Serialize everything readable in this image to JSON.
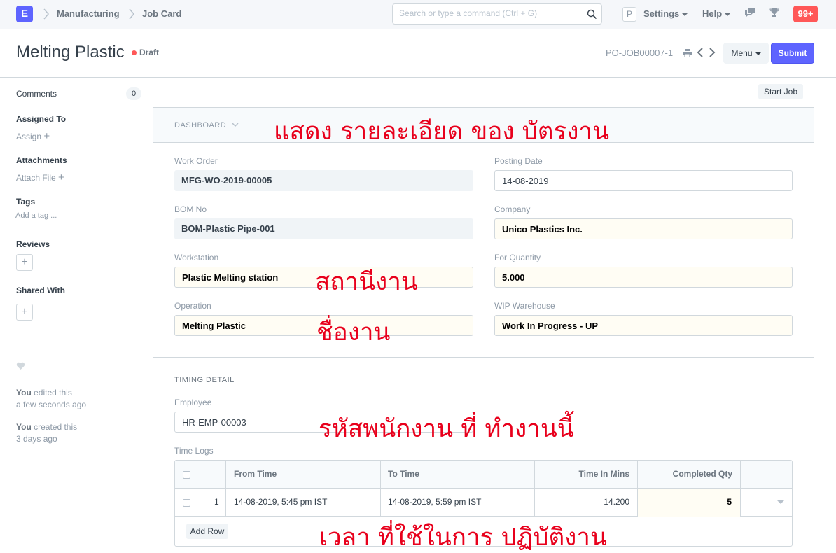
{
  "navbar": {
    "logo": "E",
    "breadcrumbs": [
      "Manufacturing",
      "Job Card"
    ],
    "search_placeholder": "Search or type a command (Ctrl + G)",
    "user_initial": "P",
    "settings_label": "Settings",
    "help_label": "Help",
    "notification_count": "99+"
  },
  "page": {
    "title": "Melting Plastic",
    "status": "Draft",
    "doc_name": "PO-JOB00007-1",
    "menu_label": "Menu",
    "submit_label": "Submit"
  },
  "sidebar": {
    "comments_label": "Comments",
    "comments_count": "0",
    "assigned_label": "Assigned To",
    "assign_link": "Assign",
    "attachments_label": "Attachments",
    "attach_link": "Attach File",
    "tags_label": "Tags",
    "tags_link": "Add a tag ...",
    "reviews_label": "Reviews",
    "shared_label": "Shared With",
    "activity": [
      {
        "user": "You",
        "action": " edited this",
        "time": "a few seconds ago"
      },
      {
        "user": "You",
        "action": " created this",
        "time": "3 days ago"
      }
    ]
  },
  "form": {
    "start_job_label": "Start Job",
    "dashboard_label": "DASHBOARD",
    "fields": {
      "work_order": {
        "label": "Work Order",
        "value": "MFG-WO-2019-00005"
      },
      "posting_date": {
        "label": "Posting Date",
        "value": "14-08-2019"
      },
      "bom_no": {
        "label": "BOM No",
        "value": "BOM-Plastic Pipe-001"
      },
      "company": {
        "label": "Company",
        "value": "Unico Plastics Inc."
      },
      "workstation": {
        "label": "Workstation",
        "value": "Plastic Melting station"
      },
      "for_quantity": {
        "label": "For Quantity",
        "value": "5.000"
      },
      "operation": {
        "label": "Operation",
        "value": "Melting Plastic"
      },
      "wip_warehouse": {
        "label": "WIP Warehouse",
        "value": "Work In Progress - UP"
      },
      "employee": {
        "label": "Employee",
        "value": "HR-EMP-00003"
      }
    },
    "timing_section": "TIMING DETAIL",
    "time_logs_label": "Time Logs",
    "time_logs": {
      "columns": [
        "From Time",
        "To Time",
        "Time In Mins",
        "Completed Qty"
      ],
      "rows": [
        {
          "idx": "1",
          "from_time": "14-08-2019, 5:45 pm IST",
          "to_time": "14-08-2019, 5:59 pm IST",
          "time_in_mins": "14.200",
          "completed_qty": "5"
        }
      ],
      "add_row_label": "Add Row"
    }
  },
  "annotations": {
    "dashboard": "แสดง รายละเอียด ของ บัตรงาน",
    "workstation": "สถานีงาน",
    "operation": "ชื่องาน",
    "employee": "รหัสพนักงาน ที่ ทำงานนี้",
    "time_logs": "เวลา ที่ใช้ในการ ปฏิบัติงาน"
  },
  "colors": {
    "primary": "#5e64ff",
    "danger": "#ff5858",
    "annotation": "#e8001c"
  }
}
